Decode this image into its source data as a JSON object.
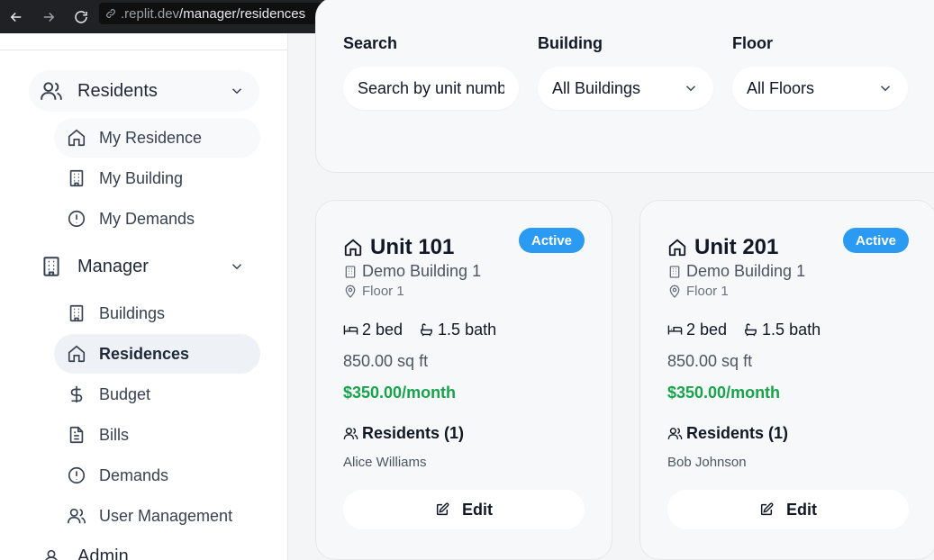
{
  "browser": {
    "url_host": ".replit.dev",
    "url_path": "/manager/residences"
  },
  "sidebar": {
    "groups": [
      {
        "label": "Residents",
        "icon": "users-icon",
        "items": [
          {
            "label": "My Residence",
            "icon": "home-icon"
          },
          {
            "label": "My Building",
            "icon": "building-icon"
          },
          {
            "label": "My Demands",
            "icon": "alert-circle-icon"
          }
        ]
      },
      {
        "label": "Manager",
        "icon": "building-icon",
        "items": [
          {
            "label": "Buildings",
            "icon": "building-icon"
          },
          {
            "label": "Residences",
            "icon": "home-icon",
            "active": true
          },
          {
            "label": "Budget",
            "icon": "dollar-icon"
          },
          {
            "label": "Bills",
            "icon": "file-text-icon"
          },
          {
            "label": "Demands",
            "icon": "alert-circle-icon"
          },
          {
            "label": "User Management",
            "icon": "users-icon"
          }
        ]
      }
    ],
    "admin_peek": "Admin"
  },
  "filters": {
    "search_label": "Search",
    "search_placeholder": "Search by unit number",
    "building_label": "Building",
    "building_value": "All Buildings",
    "floor_label": "Floor",
    "floor_value": "All Floors"
  },
  "units": [
    {
      "title": "Unit 101",
      "status": "Active",
      "building": "Demo Building 1",
      "floor": "Floor 1",
      "beds": "2 bed",
      "baths": "1.5 bath",
      "sqft": "850.00 sq ft",
      "rent": "$350.00/month",
      "residents_label": "Residents (1)",
      "resident_name": "Alice Williams",
      "edit_label": "Edit"
    },
    {
      "title": "Unit 201",
      "status": "Active",
      "building": "Demo Building 1",
      "floor": "Floor 1",
      "beds": "2 bed",
      "baths": "1.5 bath",
      "sqft": "850.00 sq ft",
      "rent": "$350.00/month",
      "residents_label": "Residents (1)",
      "resident_name": "Bob Johnson",
      "edit_label": "Edit"
    }
  ],
  "colors": {
    "status_badge": "#2b9af3",
    "rent_text": "#16a34a",
    "active_nav_bg": "#eef1f6"
  }
}
